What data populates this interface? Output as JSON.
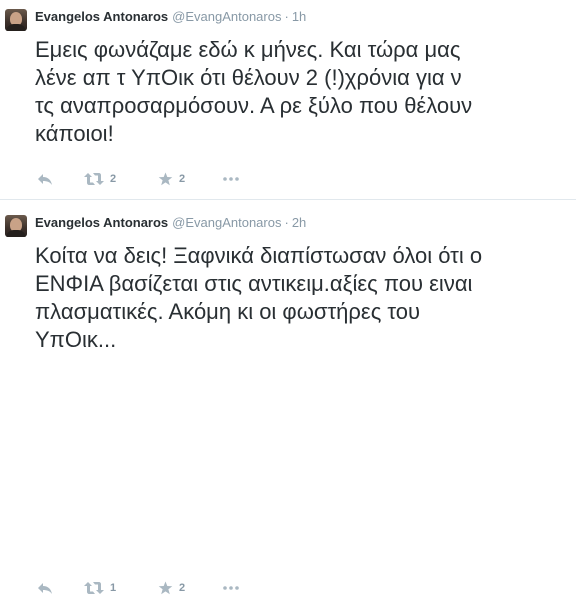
{
  "tweets": [
    {
      "name": "Evangelos Antonaros",
      "handle": "@EvangAntonaros",
      "separator": "·",
      "time": "1h",
      "text": "Εμεις φωνάζαμε εδώ κ μήνες. Και τώρα μας\nλένε απ τ ΥπΟικ ότι θέλουν 2 (!)χρόνια για ν\nτς αναπροσαρμόσουν. Α ρε ξύλο που θέλουν\nκάποιοι!",
      "retweets": "2",
      "favorites": "2"
    },
    {
      "name": "Evangelos Antonaros",
      "handle": "@EvangAntonaros",
      "separator": "·",
      "time": "2h",
      "text": "Κοίτα να δεις! Ξαφνικά διαπίστωσαν όλοι ότι ο\nΕΝΦΙΑ βασίζεται στις αντικειμ.αξίες που ειναι\nπλασματικές. Ακόμη κι οι φωστήρες του\nΥπΟικ...",
      "retweets": "1",
      "favorites": "2"
    }
  ],
  "icons": {
    "reply": "reply-icon",
    "retweet": "retweet-icon",
    "favorite": "star-icon",
    "more": "more-dots-icon"
  },
  "colors": {
    "text": "#292f33",
    "muted": "#8899a6",
    "icon": "#aab8c2",
    "divider": "#e1e8ed"
  }
}
